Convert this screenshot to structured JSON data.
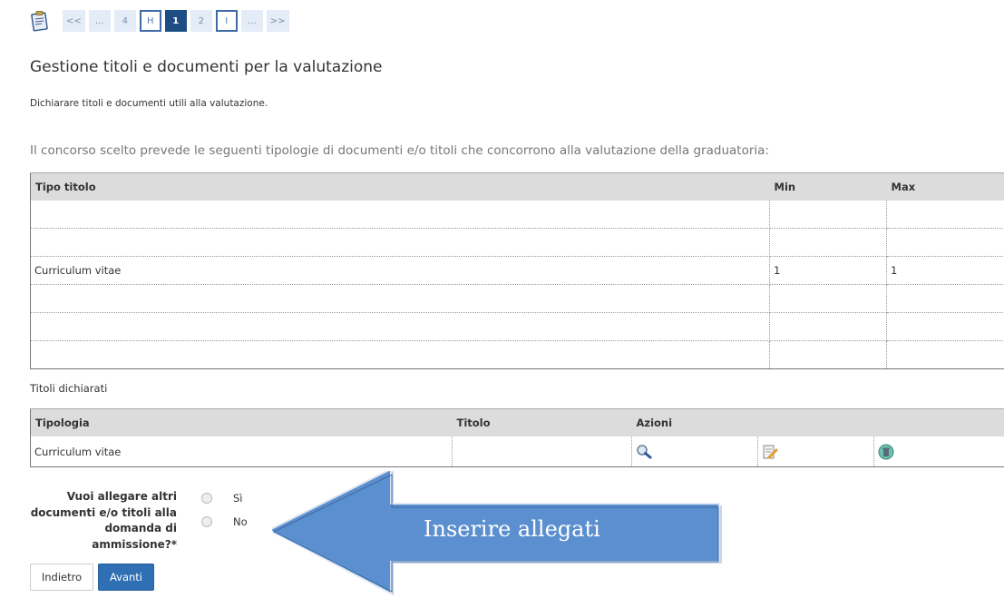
{
  "wizard": {
    "steps": [
      "<<",
      "...",
      "4",
      "H",
      "1",
      "2",
      "I",
      "...",
      ">>"
    ]
  },
  "page": {
    "title": "Gestione titoli e documenti per la valutazione",
    "subtitle": "Dichiarare titoli e documenti utili alla valutazione.",
    "intro": "Il concorso scelto prevede le seguenti tipologie di documenti e/o titoli che concorrono alla valutazione della graduatoria:"
  },
  "types_table": {
    "headers": [
      "Tipo titolo",
      "Min",
      "Max"
    ],
    "rows": [
      [
        "",
        "",
        ""
      ],
      [
        "",
        "",
        ""
      ],
      [
        "Curriculum vitae",
        "1",
        "1"
      ],
      [
        "",
        "",
        ""
      ],
      [
        "",
        "",
        ""
      ],
      [
        "",
        "",
        ""
      ]
    ]
  },
  "declared": {
    "label": "Titoli dichiarati",
    "headers": [
      "Tipologia",
      "Titolo",
      "Azioni"
    ],
    "rows": [
      {
        "tipologia": "Curriculum vitae",
        "titolo": "",
        "actions": [
          "magnifier-icon",
          "edit-icon",
          "delete-icon"
        ]
      }
    ]
  },
  "question": {
    "label": "Vuoi allegare altri documenti e/o titoli alla domanda di ammissione?*",
    "options": [
      "Sì",
      "No"
    ]
  },
  "buttons": {
    "back": "Indietro",
    "next": "Avanti"
  },
  "callout": {
    "text": "Inserire allegati",
    "color": "#4f81bd"
  },
  "colors": {
    "step_current": "#1d4d82",
    "primary_button": "#2f6fb3"
  }
}
